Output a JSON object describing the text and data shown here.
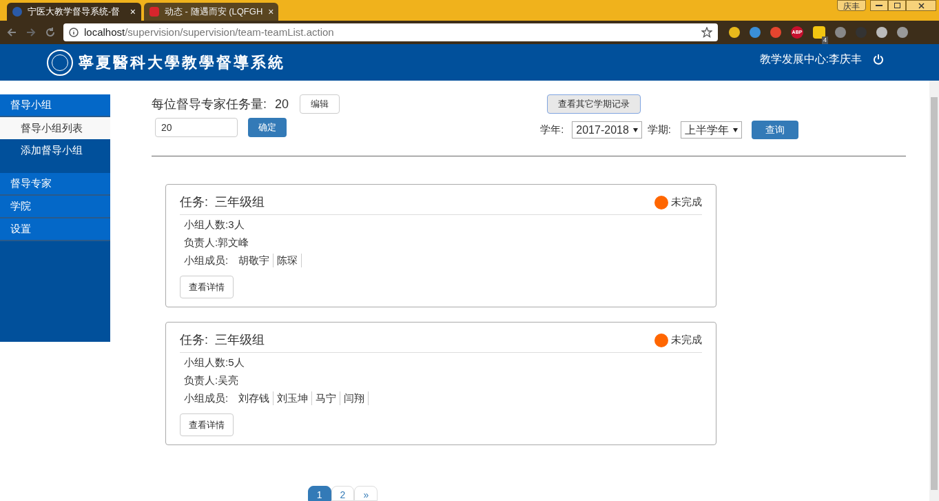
{
  "browser": {
    "tabs": [
      {
        "title": "宁医大教学督导系统-督",
        "close": "×",
        "selected": true
      },
      {
        "title": "动态 - 随遇而安 (LQFGH",
        "close": "×",
        "selected": false
      }
    ],
    "profile": "庆丰",
    "url_host": "localhost",
    "url_path": "/supervision/supervision/team-teamList.action",
    "extensions": [
      {
        "kind": "plain",
        "color": "#e8b91c"
      },
      {
        "kind": "plain",
        "color": "#3a8fd8"
      },
      {
        "kind": "plain",
        "color": "#e5452f"
      },
      {
        "kind": "abp",
        "label": "ABP",
        "color": "#c8102e"
      },
      {
        "kind": "badge",
        "label": "4",
        "color": "#f2c511"
      },
      {
        "kind": "plain",
        "color": "#888888"
      },
      {
        "kind": "plain",
        "color": "#333333"
      },
      {
        "kind": "plain",
        "color": "#bbbbbb"
      },
      {
        "kind": "plain",
        "color": "#999999"
      }
    ]
  },
  "header": {
    "title": "寧夏醫科大學教學督導系統",
    "user": "教学发展中心:李庆丰"
  },
  "sidebar": [
    {
      "label": "督导小组",
      "children": [
        {
          "label": "督导小组列表",
          "selected": true
        },
        {
          "label": "添加督导小组",
          "selected": false
        }
      ]
    },
    {
      "label": "督导专家"
    },
    {
      "label": "学院"
    },
    {
      "label": "设置"
    }
  ],
  "quota": {
    "label": "每位督导专家任务量:",
    "value": "20",
    "edit_button": "编辑",
    "input_value": "20",
    "confirm_button": "确定"
  },
  "filter": {
    "history_button": "查看其它学期记录",
    "year_label": "学年:",
    "year": "2017-2018",
    "term_label": "学期:",
    "term": "上半学年",
    "query_button": "查询"
  },
  "teams": [
    {
      "task_label": "任务:",
      "task": "三年级组",
      "status": "未完成",
      "color": "#ff6600",
      "count": "小组人数:3人",
      "leader": "负责人:郭文峰",
      "members_label": "小组成员:",
      "members": [
        "胡敬宇",
        "陈琛"
      ],
      "detail_button": "查看详情"
    },
    {
      "task_label": "任务:",
      "task": "三年级组",
      "status": "未完成",
      "color": "#ff6600",
      "count": "小组人数:5人",
      "leader": "负责人:吴亮",
      "members_label": "小组成员:",
      "members": [
        "刘存钱",
        "刘玉坤",
        "马宁",
        "闫翔"
      ],
      "detail_button": "查看详情"
    }
  ],
  "pagination": [
    {
      "label": "1",
      "selected": true
    },
    {
      "label": "2",
      "selected": false
    },
    {
      "label": "»",
      "selected": false
    }
  ]
}
